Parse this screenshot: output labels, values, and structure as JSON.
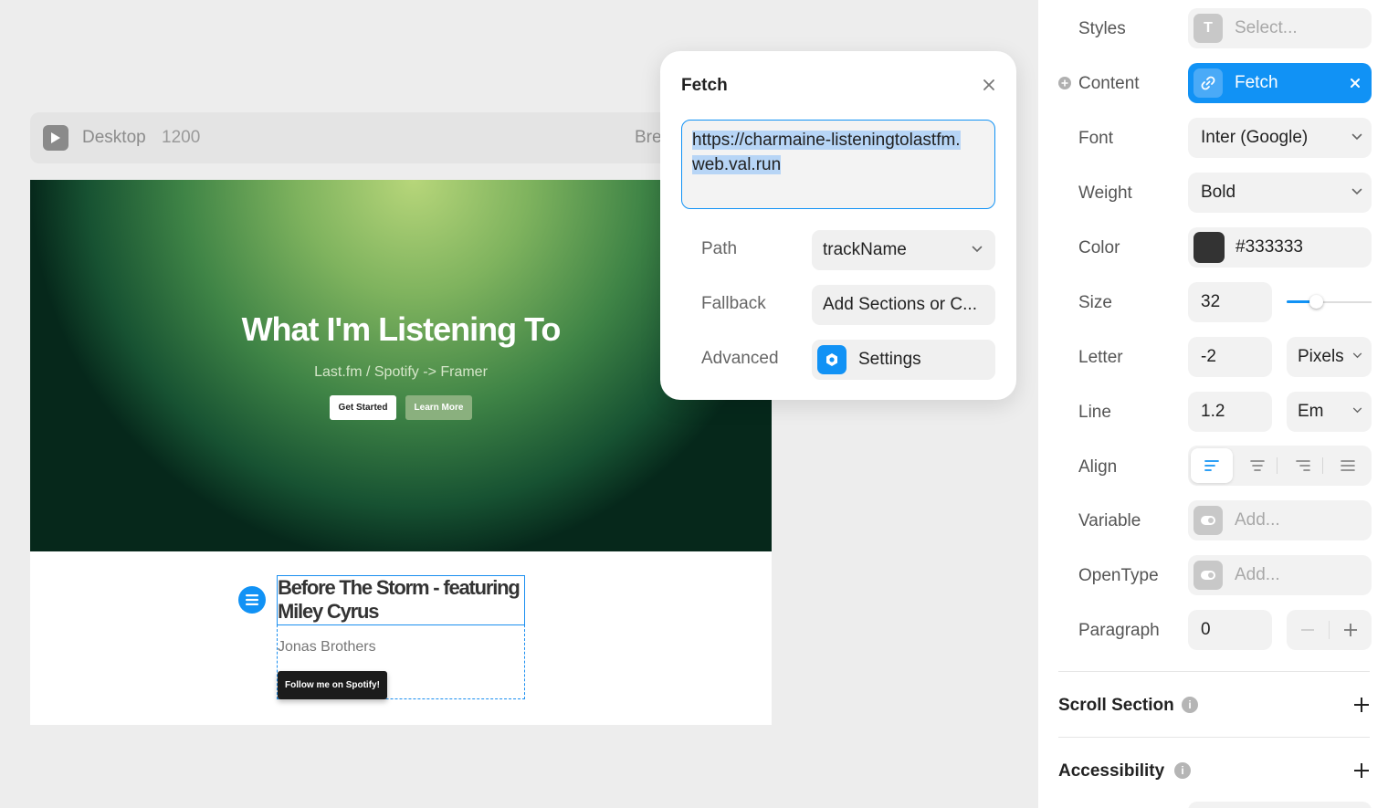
{
  "canvas": {
    "breakpoint_name": "Desktop",
    "breakpoint_width": "1200",
    "next_breakpoint_partial": "Bre",
    "hero": {
      "title": "What I'm Listening To",
      "subtitle": "Last.fm / Spotify -> Framer",
      "primary_button": "Get Started",
      "secondary_button": "Learn More"
    },
    "track": {
      "name": "Before The Storm - featuring Miley Cyrus",
      "artist": "Jonas Brothers",
      "follow_button": "Follow me on Spotify!"
    }
  },
  "fetch_popover": {
    "title": "Fetch",
    "url": "https://charmaine-listeningtolastfm.web.val.run",
    "url_line1": "https://charmaine-listeningtolastfm.",
    "url_line2": "web.val.run",
    "path_label": "Path",
    "path_value": "trackName",
    "fallback_label": "Fallback",
    "fallback_value": "Add Sections or C...",
    "advanced_label": "Advanced",
    "advanced_value": "Settings"
  },
  "panel": {
    "styles": {
      "label": "Styles",
      "placeholder": "Select..."
    },
    "content": {
      "label": "Content",
      "value": "Fetch"
    },
    "font": {
      "label": "Font",
      "value": "Inter (Google)"
    },
    "weight": {
      "label": "Weight",
      "value": "Bold"
    },
    "color": {
      "label": "Color",
      "value": "#333333"
    },
    "size": {
      "label": "Size",
      "value": "32",
      "slider_fraction": 0.3
    },
    "letter": {
      "label": "Letter",
      "value": "-2",
      "unit": "Pixels"
    },
    "line": {
      "label": "Line",
      "value": "1.2",
      "unit": "Em"
    },
    "align": {
      "label": "Align",
      "selected": "left"
    },
    "variable": {
      "label": "Variable",
      "placeholder": "Add..."
    },
    "opentype": {
      "label": "OpenType",
      "placeholder": "Add..."
    },
    "paragraph": {
      "label": "Paragraph",
      "value": "0"
    },
    "scroll_section": "Scroll Section",
    "accessibility": "Accessibility"
  },
  "colors": {
    "accent": "#1192f5",
    "text_color_value": "#333333"
  }
}
